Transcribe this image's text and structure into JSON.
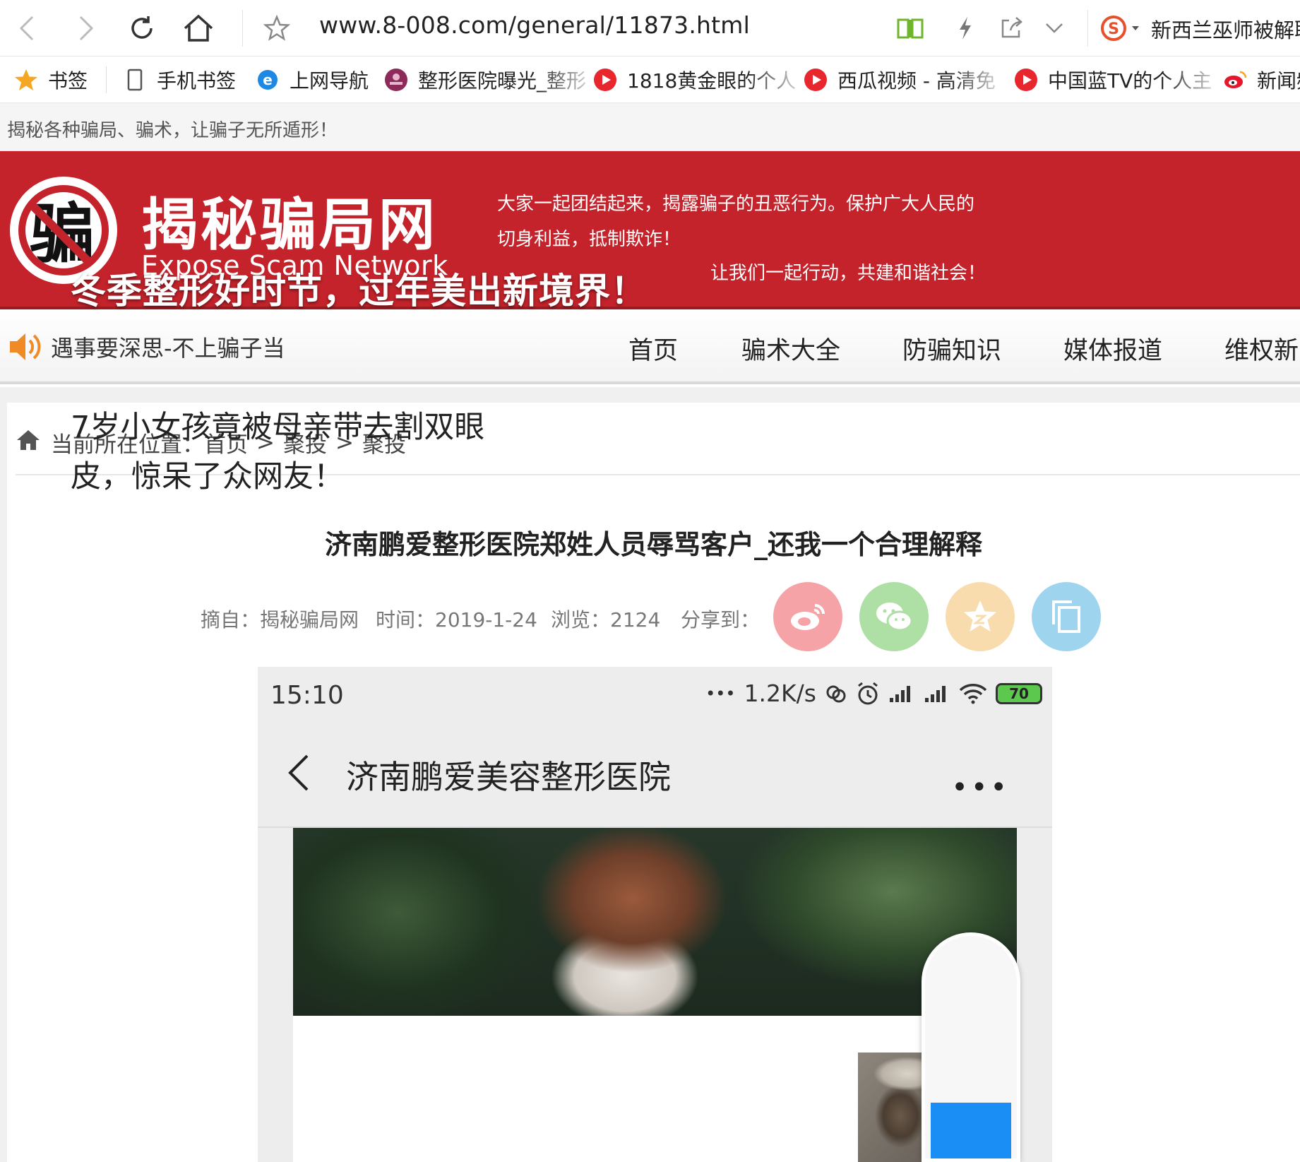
{
  "browser": {
    "url": "www.8-008.com/general/11873.html",
    "search_hint": "新西兰巫师被解职"
  },
  "bookmarks": [
    {
      "label": "书签",
      "icon": "star-icon"
    },
    {
      "label": "手机书签",
      "icon": "phone-icon"
    },
    {
      "label": "上网导航",
      "icon": "ie-icon"
    },
    {
      "label": "整形医院曝光_整形",
      "icon": "hospital-logo-icon"
    },
    {
      "label": "1818黄金眼的个人",
      "icon": "play-icon"
    },
    {
      "label": "西瓜视频 - 高清免",
      "icon": "play-icon"
    },
    {
      "label": "中国蓝TV的个人主",
      "icon": "play-icon"
    },
    {
      "label": "新闻频",
      "icon": "weibo-icon"
    }
  ],
  "site": {
    "topstrip": "揭秘各种骗局、骗术，让骗子无所遁形！",
    "logo_char": "骗",
    "logo_title": "揭秘骗局网",
    "logo_sub": "Expose Scam Network",
    "slogan_line1": "大家一起团结起来，揭露骗子的丑恶行为。保护广大人民的",
    "slogan_line2": "切身利益，抵制欺诈！",
    "slogan_line3": "让我们一起行动，共建和谐社会！",
    "nav_tip": "遇事要深思-不上骗子当",
    "nav": [
      "首页",
      "骗术大全",
      "防骗知识",
      "媒体报道",
      "维权新闻"
    ]
  },
  "breadcrumb": {
    "label": "当前所在位置：",
    "items": [
      "首页",
      "聚投",
      "聚投"
    ],
    "separator": ">"
  },
  "article": {
    "title": "济南鹏爱整形医院郑姓人员辱骂客户_还我一个合理解释",
    "source": "摘自：揭秘骗局网",
    "time": "时间：2019-1-24",
    "views": "浏览：2124",
    "share_label": "分享到："
  },
  "share_buttons": [
    {
      "name": "weibo",
      "color": "#f5a3a6"
    },
    {
      "name": "wechat",
      "color": "#aee0a6"
    },
    {
      "name": "qzone",
      "color": "#f9dcae"
    },
    {
      "name": "copy",
      "color": "#9fd4ef"
    }
  ],
  "phone": {
    "time": "15:10",
    "dots": "•••",
    "speed": "1.2K/s",
    "battery": "70",
    "title": "济南鹏爱美容整形医院",
    "more": "•••",
    "banner_text": "冬季整形好时节，过年美出新境界！",
    "card_text": "7岁小女孩竟被母亲带去割双眼皮，惊呆了众网友！",
    "scroll_level": 0.25
  },
  "colors": {
    "brand_red": "#c4232b",
    "scroll_blue": "#1a8ef5"
  }
}
